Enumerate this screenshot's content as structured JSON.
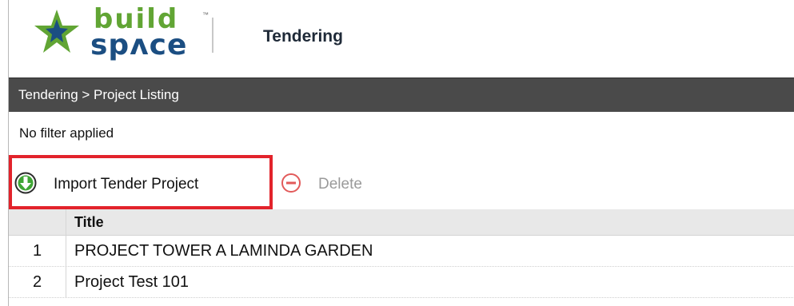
{
  "header": {
    "logo": {
      "word1": "build",
      "word2": "spᴧce",
      "tm": "™"
    },
    "app_title": "Tendering"
  },
  "breadcrumb": {
    "text": "Tendering > Project Listing"
  },
  "filter": {
    "text": "No filter applied"
  },
  "toolbar": {
    "import_label": "Import Tender Project",
    "delete_label": "Delete",
    "import_icon": "download-arrow-icon",
    "delete_icon": "minus-circle-icon"
  },
  "table": {
    "headers": {
      "num": "",
      "title": "Title"
    },
    "rows": [
      {
        "num": "1",
        "title": "PROJECT TOWER A LAMINDA GARDEN"
      },
      {
        "num": "2",
        "title": "Project Test 101"
      }
    ]
  },
  "colors": {
    "brand_green": "#61a534",
    "brand_blue": "#1b4e82",
    "breadcrumb_bg": "#4a4a4a",
    "highlight_red": "#e2232b"
  }
}
